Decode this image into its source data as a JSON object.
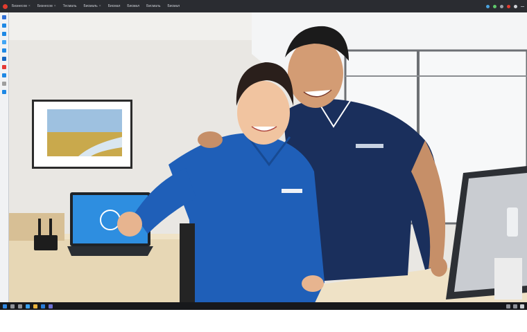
{
  "browser": {
    "tabs": [
      {
        "label": "Бизнесов"
      },
      {
        "label": "Бизнесов"
      },
      {
        "label": "Тесмаль"
      },
      {
        "label": "Бисмаль"
      },
      {
        "label": "Бисмал"
      },
      {
        "label": "Бисмал"
      },
      {
        "label": "Бисмаль"
      },
      {
        "label": "Бисмал"
      }
    ],
    "accent_color": "#e33b2e",
    "bar_color": "#2a2c31"
  },
  "left_toolbar": {
    "icons": [
      "app-icon",
      "blue-icon",
      "blue-icon",
      "blue-icon",
      "blue-icon",
      "blue-icon",
      "red-icon",
      "blue-icon",
      "gray-icon",
      "blue-icon"
    ]
  },
  "photo": {
    "description_colors": {
      "uniform_blue": "#1f5fb8",
      "uniform_navy": "#1a2f5c",
      "desk": "#efe2c6"
    }
  },
  "taskbar": {
    "icons": [
      "start-icon",
      "search-icon",
      "task-view-icon",
      "browser-icon",
      "files-icon",
      "mail-icon",
      "store-icon"
    ],
    "tray": [
      "network-icon",
      "volume-icon",
      "clock-icon"
    ]
  }
}
